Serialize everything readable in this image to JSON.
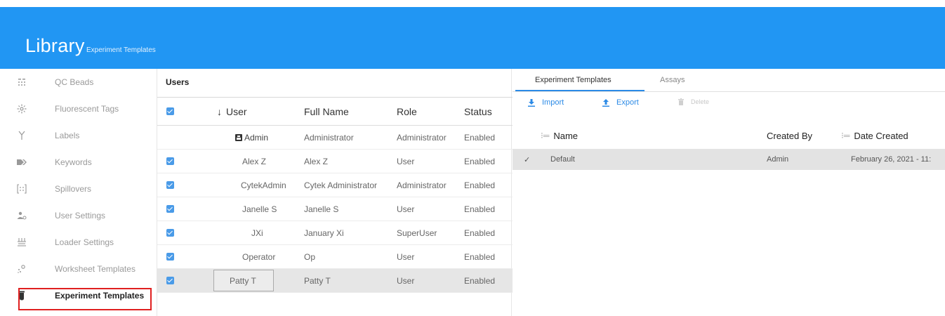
{
  "header": {
    "title": "Library",
    "subtitle": "Experiment Templates"
  },
  "sidebar": {
    "items": [
      {
        "label": "QC Beads",
        "icon": "qc-beads-icon"
      },
      {
        "label": "Fluorescent Tags",
        "icon": "fluorescent-tags-icon"
      },
      {
        "label": "Labels",
        "icon": "labels-icon"
      },
      {
        "label": "Keywords",
        "icon": "keywords-icon"
      },
      {
        "label": "Spillovers",
        "icon": "spillovers-icon"
      },
      {
        "label": "User Settings",
        "icon": "user-settings-icon"
      },
      {
        "label": "Loader Settings",
        "icon": "loader-settings-icon"
      },
      {
        "label": "Worksheet Templates",
        "icon": "worksheet-templates-icon"
      },
      {
        "label": "Experiment Templates",
        "icon": "experiment-templates-icon",
        "active": true
      }
    ]
  },
  "users": {
    "title": "Users",
    "columns": {
      "user": "User",
      "sort_indicator": "↓",
      "full_name": "Full Name",
      "role": "Role",
      "status": "Status"
    },
    "group_icon": "group-icon",
    "group_label": "Admin",
    "group_row": {
      "full_name": "Administrator",
      "role": "Administrator",
      "status": "Enabled"
    },
    "rows": [
      {
        "user": "Alex Z",
        "full_name": "Alex Z",
        "role": "User",
        "status": "Enabled",
        "checked": true
      },
      {
        "user": "CytekAdmin",
        "full_name": "Cytek Administrator",
        "role": "Administrator",
        "status": "Enabled",
        "checked": true
      },
      {
        "user": "Janelle S",
        "full_name": "Janelle S",
        "role": "User",
        "status": "Enabled",
        "checked": true
      },
      {
        "user": "JXi",
        "full_name": "January Xi",
        "role": "SuperUser",
        "status": "Enabled",
        "checked": true
      },
      {
        "user": "Operator",
        "full_name": "Op",
        "role": "User",
        "status": "Enabled",
        "checked": true
      },
      {
        "user": "Patty T",
        "full_name": "Patty T",
        "role": "User",
        "status": "Enabled",
        "checked": true,
        "selected": true
      }
    ]
  },
  "templates": {
    "tabs": [
      "Experiment Templates",
      "Assays"
    ],
    "toolbar": {
      "import": "Import",
      "export": "Export",
      "delete": "Delete"
    },
    "columns": {
      "name": "Name",
      "created_by": "Created By",
      "date_created": "Date Created"
    },
    "rows": [
      {
        "name": "Default",
        "created_by": "Admin",
        "date_created": "February 26, 2021 - 11:",
        "check": "✓"
      }
    ]
  },
  "colors": {
    "header": "#2196f3",
    "accent": "#2b8ae6",
    "highlight_frame": "#e02020"
  }
}
